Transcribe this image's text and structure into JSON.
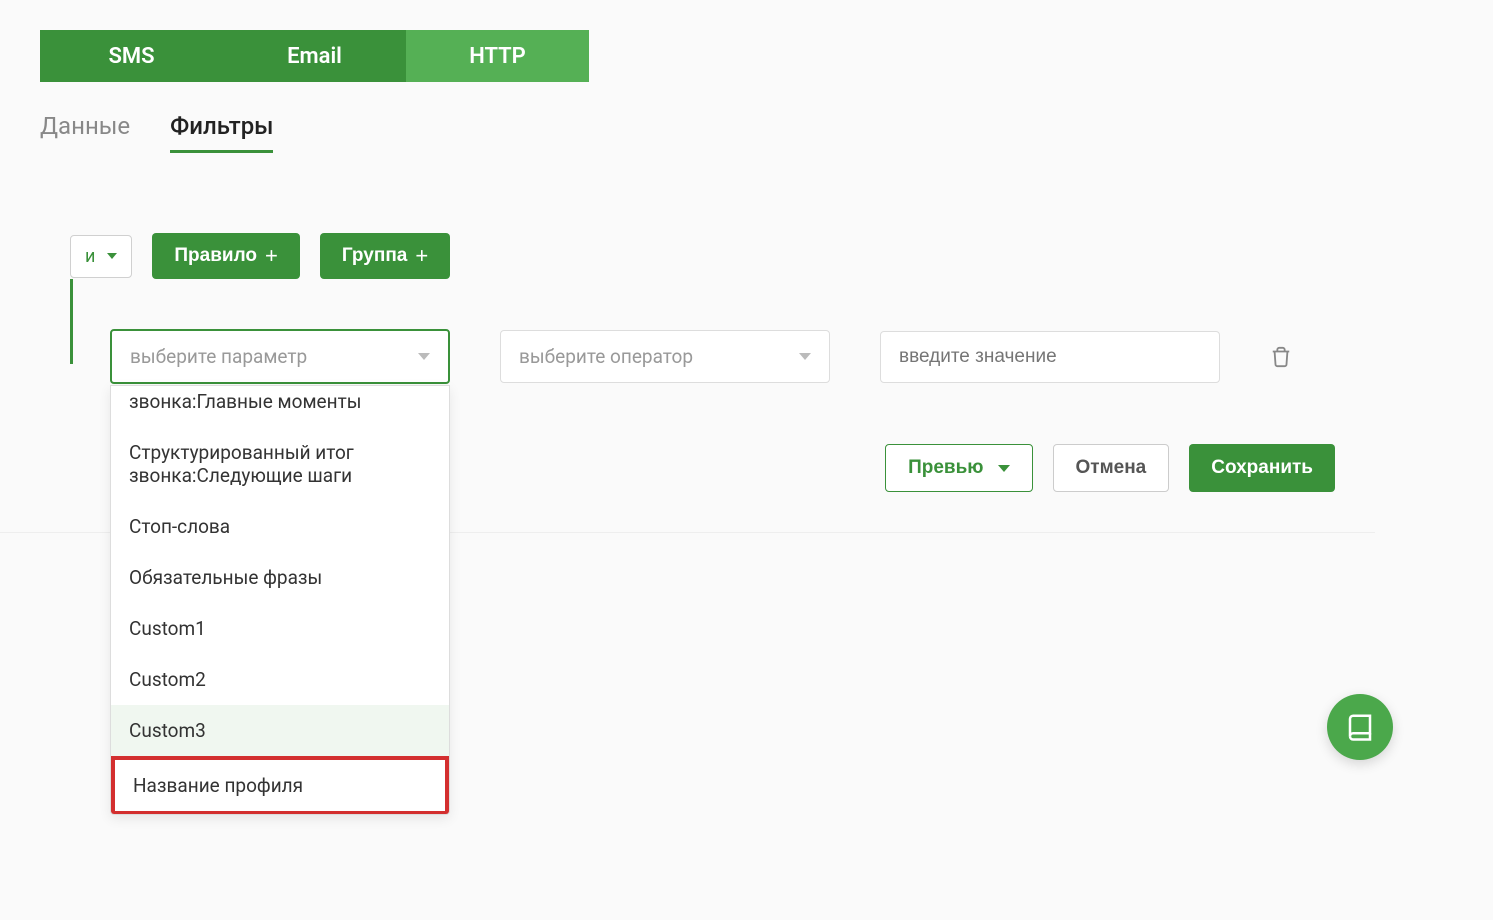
{
  "channels": {
    "sms": "SMS",
    "email": "Email",
    "http": "HTTP"
  },
  "subtabs": {
    "data": "Данные",
    "filters": "Фильтры"
  },
  "logic": {
    "label": "и"
  },
  "buttons": {
    "rule": "Правило",
    "group": "Группа",
    "preview": "Превью",
    "cancel": "Отмена",
    "save": "Сохранить"
  },
  "selects": {
    "param_placeholder": "выберите параметр",
    "operator_placeholder": "выберите оператор",
    "value_placeholder": "введите значение"
  },
  "dropdown": {
    "items": [
      "звонка:Главные моменты",
      "Структурированный итог звонка:Следующие шаги",
      "Стоп-слова",
      "Обязательные фразы",
      "Custom1",
      "Custom2",
      "Custom3",
      "Название профиля"
    ]
  }
}
